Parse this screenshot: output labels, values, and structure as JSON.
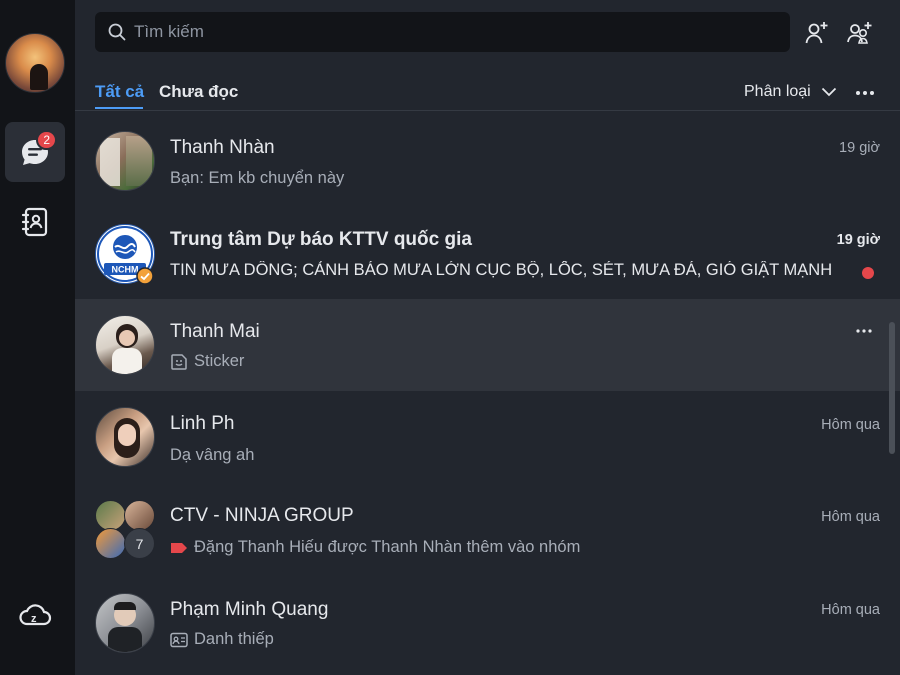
{
  "search": {
    "placeholder": "Tìm kiếm"
  },
  "sidebar": {
    "messages_badge": "2"
  },
  "tabs": [
    {
      "label": "Tất cả"
    },
    {
      "label": "Chưa đọc"
    }
  ],
  "filter": {
    "label": "Phân loại"
  },
  "conversations": [
    {
      "name": "Thanh Nhàn",
      "preview": "Bạn: Em kb chuyển này",
      "time": "19 giờ"
    },
    {
      "name": "Trung tâm Dự báo KTTV quốc gia",
      "preview": "TIN MƯA DÔNG; CẢNH BÁO MƯA LỚN CỤC BỘ, LỐC, SÉT, MƯA ĐÁ, GIÓ GIẬT MẠNH",
      "time": "19 giờ",
      "avatar_text": "NCHM"
    },
    {
      "name": "Thanh Mai",
      "preview": "Sticker",
      "time": ""
    },
    {
      "name": "Linh Ph",
      "preview": "Dạ vâng ah",
      "time": "Hôm qua"
    },
    {
      "name": "CTV - NINJA GROUP",
      "preview": "Đặng Thanh Hiếu được Thanh Nhàn thêm vào nhóm",
      "time": "Hôm qua",
      "member_count": "7"
    },
    {
      "name": "Phạm Minh Quang",
      "preview": "Danh thiếp",
      "time": "Hôm qua"
    }
  ],
  "colors": {
    "accent": "#4d9cf6",
    "unread": "#e5474b",
    "background": "#22262e",
    "rail": "#121418",
    "hover": "#30343c"
  },
  "icons": [
    "search-icon",
    "add-friend-icon",
    "create-group-icon",
    "chat-icon",
    "contacts-icon",
    "cloud-icon",
    "chevron-down-icon",
    "more-icon",
    "sticker-icon",
    "tag-icon",
    "business-card-icon",
    "verified-icon"
  ]
}
